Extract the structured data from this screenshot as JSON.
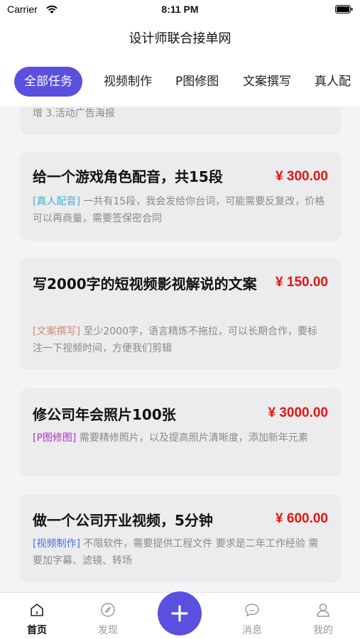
{
  "status_bar": {
    "carrier": "Carrier",
    "time": "8:11 PM"
  },
  "nav": {
    "title": "设计师联合接单网"
  },
  "tabs": [
    {
      "label": "全部任务",
      "active": true
    },
    {
      "label": "视频制作",
      "active": false
    },
    {
      "label": "P图修图",
      "active": false
    },
    {
      "label": "文案撰写",
      "active": false
    },
    {
      "label": "真人配",
      "active": false
    }
  ],
  "partial_card": {
    "desc": "增 3.活动广告海报"
  },
  "tasks": [
    {
      "title": "给一个游戏角色配音，共15段",
      "price": "¥ 300.00",
      "tag": "[真人配音]",
      "tag_color": "#3fb3c8",
      "desc": "一共有15段，我会发给你台词，可能需要反复改，价格可以再商量，需要签保密合同"
    },
    {
      "title": "写2000字的短视频影视解说的文案",
      "price": "¥ 150.00",
      "tag": "[文案撰写]",
      "tag_color": "#c98a7a",
      "desc": "至少2000字，语言精炼不拖拉，可以长期合作，要标注一下视频时间，方便我们剪辑"
    },
    {
      "title": "修公司年会照片100张",
      "price": "¥ 3000.00",
      "tag": "[P图修图]",
      "tag_color": "#b032c9",
      "desc": "需要精修照片，以及提高照片清晰度，添加新年元素"
    },
    {
      "title": "做一个公司开业视频，5分钟",
      "price": "¥ 600.00",
      "tag": "[视频制作]",
      "tag_color": "#4a6ee0",
      "desc": "不限软件，需要提供工程文件 要求是二年工作经验 需要加字幕、滤镜、转场"
    }
  ],
  "tabbar": {
    "home": "首页",
    "discover": "发现",
    "messages": "消息",
    "mine": "我的",
    "add_icon": "plus-icon"
  },
  "colors": {
    "accent": "#5b4fe0",
    "price": "#e8150f"
  }
}
